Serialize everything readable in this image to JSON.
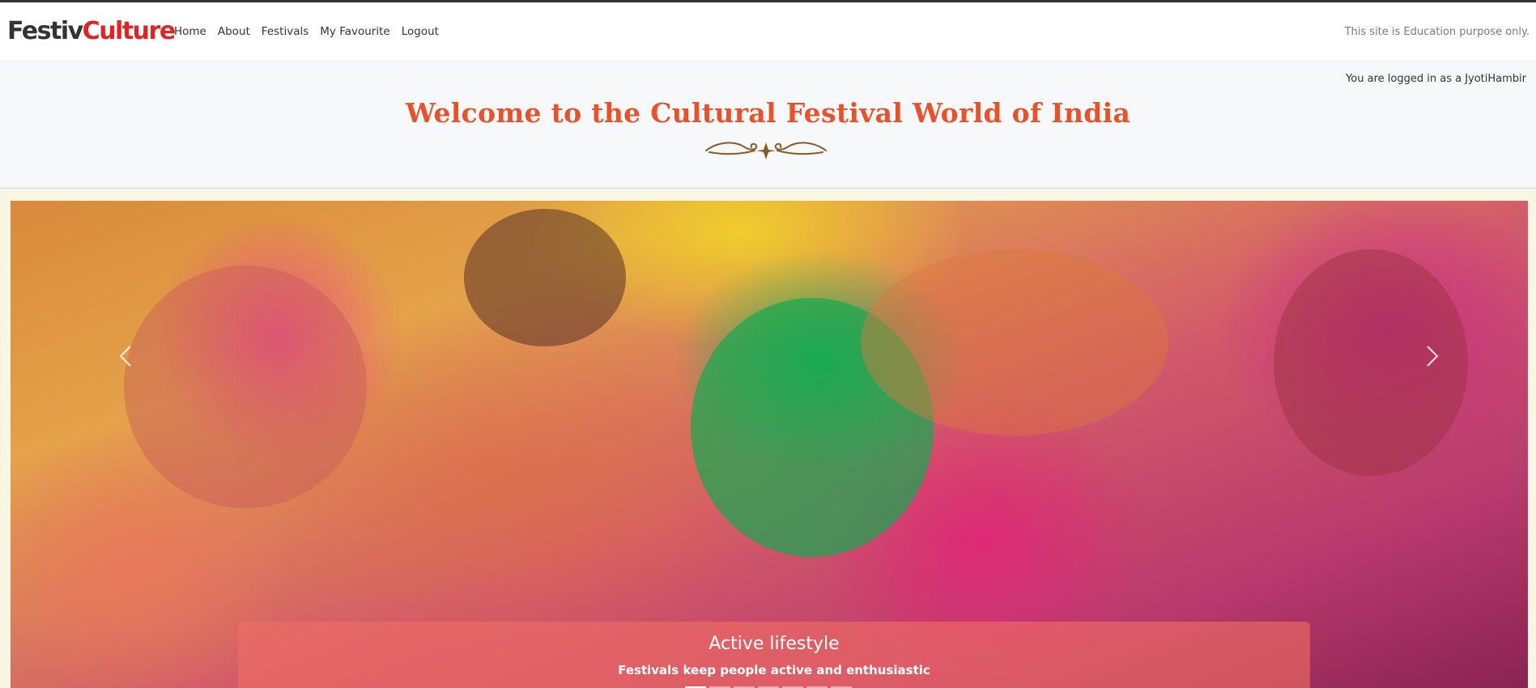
{
  "brand": {
    "part1": "Festiv",
    "part2": "Culture"
  },
  "nav": {
    "items": [
      {
        "label": "Home"
      },
      {
        "label": "About"
      },
      {
        "label": "Festivals"
      },
      {
        "label": "My Favourite"
      },
      {
        "label": "Logout"
      }
    ],
    "note": "This site is Education purpose only."
  },
  "header": {
    "login_note": "You are logged in as a JyotiHambir",
    "title": "Welcome to the Cultural Festival World of India"
  },
  "carousel": {
    "caption_title": "Active lifestyle",
    "caption_subtitle": "Festivals keep people active and enthusiastic",
    "indicator_count": 7,
    "active_indicator": 0,
    "prev_icon": "chevron-left-icon",
    "next_icon": "chevron-right-icon"
  },
  "colors": {
    "brand_dark": "#333333",
    "brand_red": "#e02424",
    "title_orange": "#e8522a",
    "ornament_brown": "#8b5a2b"
  }
}
